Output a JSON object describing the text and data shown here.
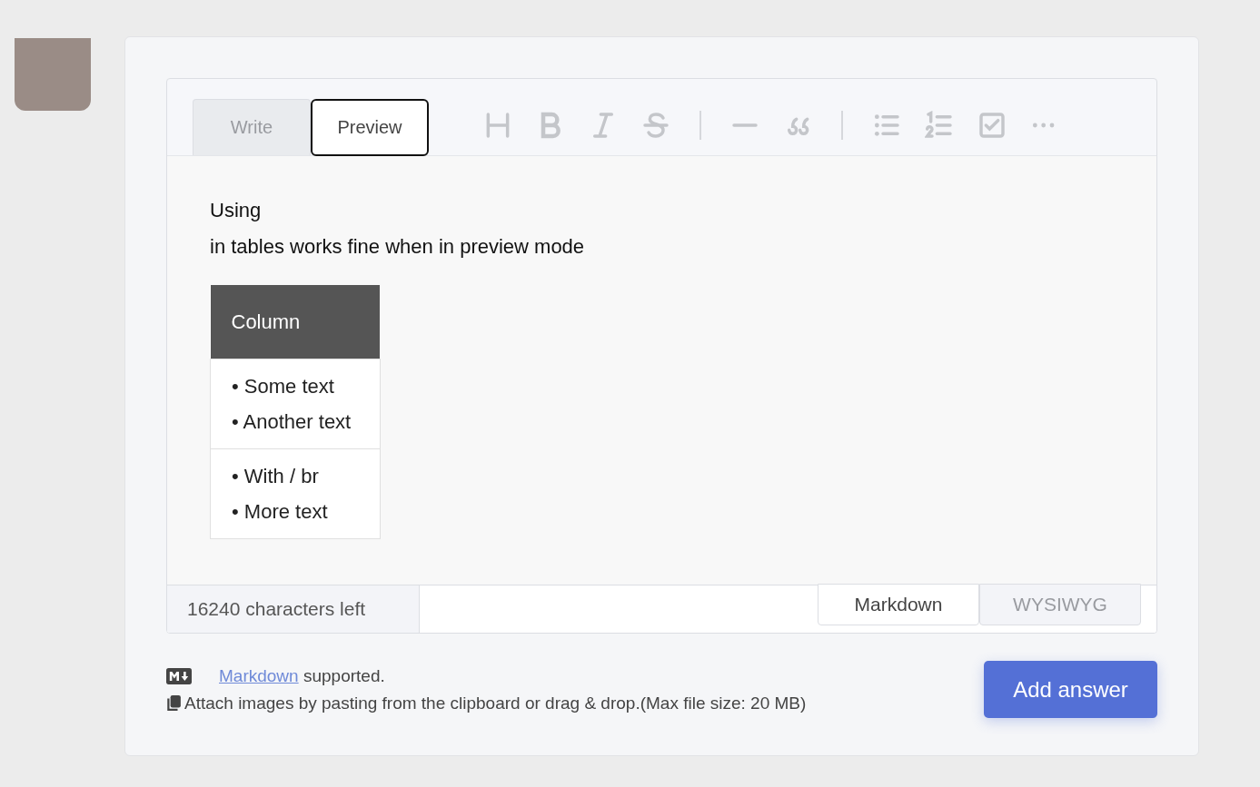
{
  "editor": {
    "tabs": [
      {
        "label": "Write",
        "selected": false
      },
      {
        "label": "Preview",
        "selected": true
      }
    ],
    "toolbar": [
      {
        "kind": "heading"
      },
      {
        "kind": "bold"
      },
      {
        "kind": "italic"
      },
      {
        "kind": "strike"
      },
      {
        "kind": "divider"
      },
      {
        "kind": "rule"
      },
      {
        "kind": "quote"
      },
      {
        "kind": "divider"
      },
      {
        "kind": "bullets"
      },
      {
        "kind": "numbers"
      },
      {
        "kind": "task"
      },
      {
        "kind": "more"
      }
    ],
    "preview": {
      "lines": [
        "Using",
        "in tables works fine when in preview mode"
      ],
      "table": {
        "header": "Column",
        "rows": [
          [
            "• Some text",
            "• Another text"
          ],
          [
            "• With / br",
            "• More text"
          ]
        ]
      }
    },
    "counter": "16240 characters left",
    "modes": [
      {
        "label": "Markdown",
        "selected": true
      },
      {
        "label": "WYSIWYG",
        "selected": false
      }
    ]
  },
  "help": {
    "link": "Markdown",
    "after": " supported.",
    "attach": "Attach images by pasting from the clipboard or drag & drop.(Max file size: 20 MB)"
  },
  "submit": "Add answer"
}
